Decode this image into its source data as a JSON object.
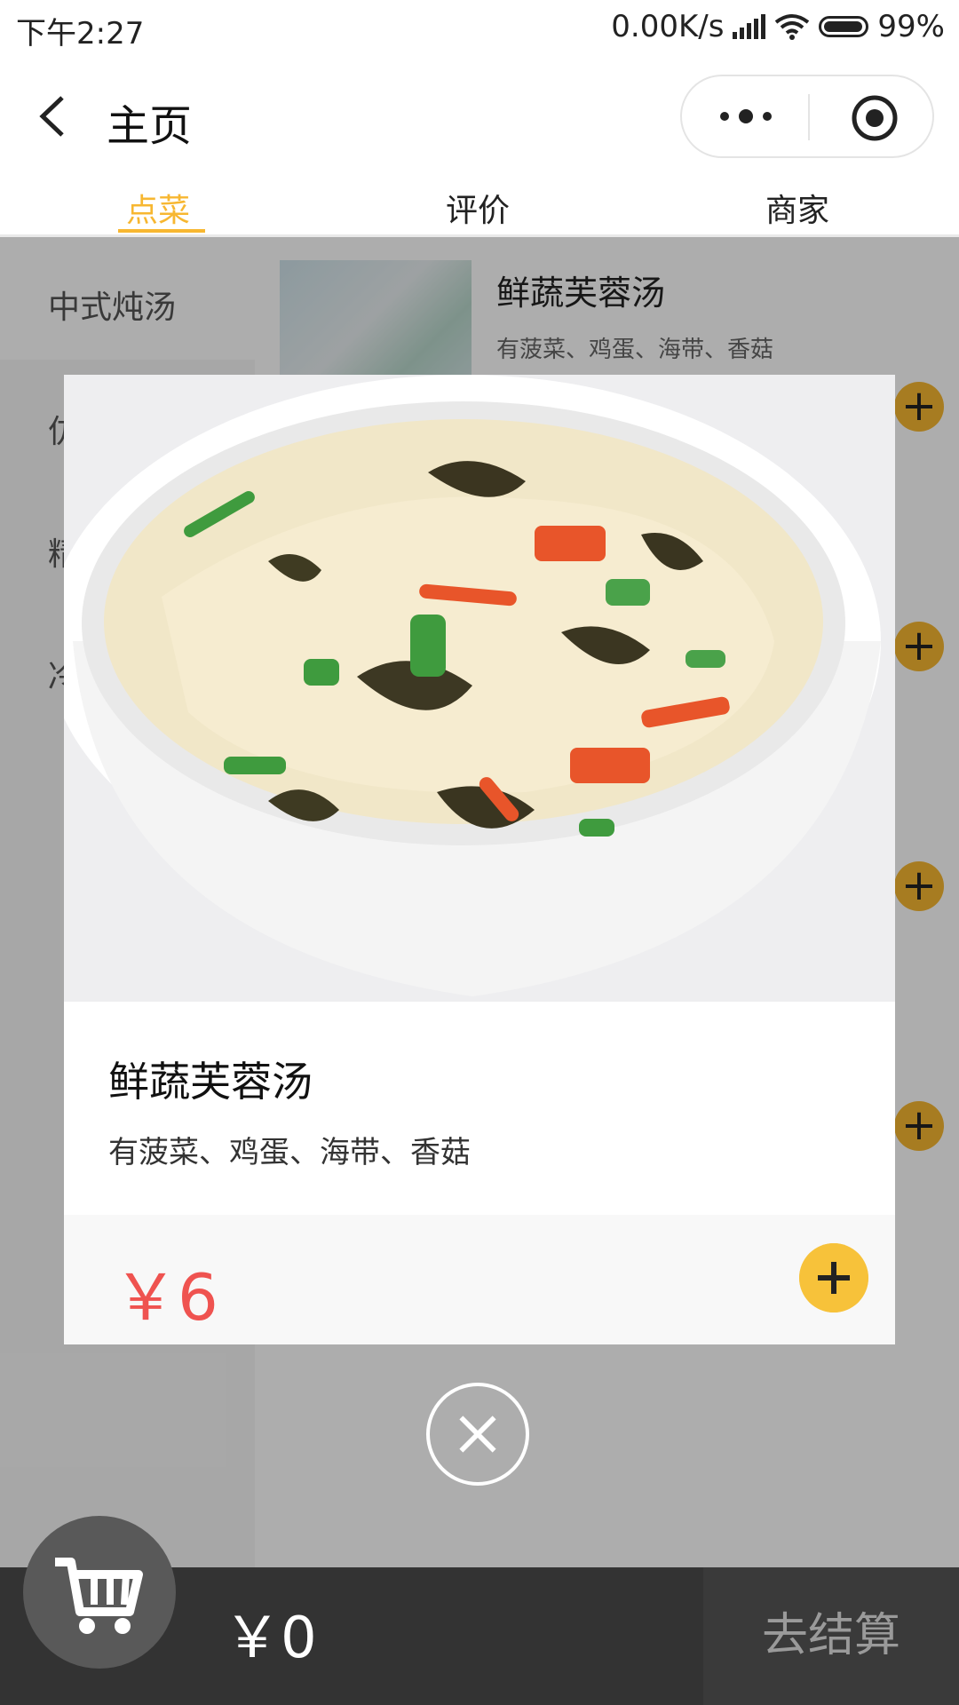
{
  "status_bar": {
    "time": "下午2:27",
    "network_speed": "0.00K/s",
    "battery": "99%"
  },
  "nav": {
    "title": "主页"
  },
  "tabs": [
    {
      "label": "点菜",
      "active": true
    },
    {
      "label": "评价",
      "active": false
    },
    {
      "label": "商家",
      "active": false
    }
  ],
  "categories": [
    {
      "label": "中式炖汤"
    },
    {
      "label": "仿"
    },
    {
      "label": "精"
    },
    {
      "label": "冷"
    }
  ],
  "background_item": {
    "title": "鲜蔬芙蓉汤",
    "desc": "有菠菜、鸡蛋、海带、香菇"
  },
  "modal": {
    "title": "鲜蔬芙蓉汤",
    "desc": "有菠菜、鸡蛋、海带、香菇",
    "price": "￥6"
  },
  "bottom": {
    "total": "￥0",
    "checkout_label": "去结算"
  },
  "colors": {
    "accent": "#f7b731",
    "price": "#ef5350",
    "bottom_bar": "#333333"
  }
}
